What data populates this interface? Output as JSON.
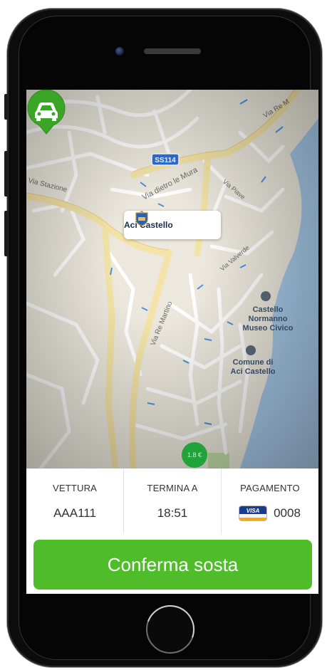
{
  "map": {
    "labels": {
      "ss114": "SS114",
      "via_dietro_le_mura": "Via dietro le Mura",
      "via_stazione": "Via Stazione",
      "via_piave": "Via Piave",
      "via_valverde": "Via Valverde",
      "via_re_martino": "Via Re Martino",
      "via_re_top": "Via Re M",
      "castello_1": "Castello",
      "castello_2": "Normanno",
      "castello_3": "Museo Civico",
      "comune_1": "Comune di",
      "comune_2": "Aci Castello"
    },
    "callout_text": "Aci Castello",
    "pin_icon": "car-icon",
    "price_badge": "1.8 €",
    "colors": {
      "pin": "#3aa526",
      "water": "#a6c9e8",
      "road_major": "#f3e3a6"
    }
  },
  "summary": {
    "vehicle_label": "VETTURA",
    "vehicle_value": "AAA111",
    "ends_label": "TERMINA A",
    "ends_value": "18:51",
    "payment_label": "PAGAMENTO",
    "payment_card": "VISA",
    "payment_value": "0008"
  },
  "actions": {
    "confirm_label": "Conferma sosta",
    "confirm_color": "#4fbd2a"
  }
}
